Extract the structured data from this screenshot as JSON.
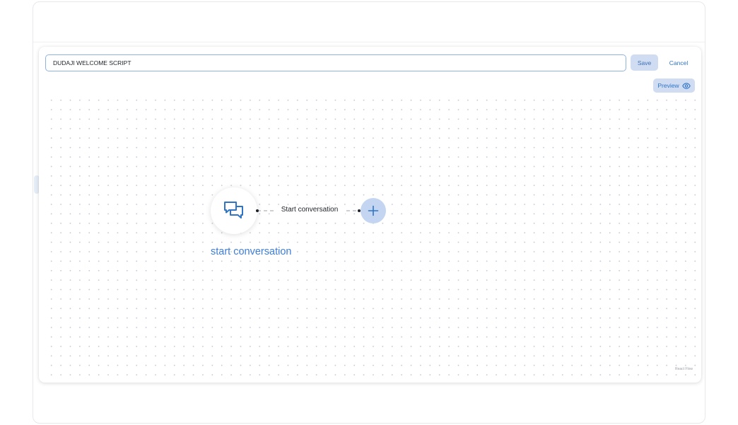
{
  "editor": {
    "script_title_value": "DUDAJI WELCOME SCRIPT",
    "save_label": "Save",
    "cancel_label": "Cancel",
    "preview_label": "Preview"
  },
  "flow": {
    "start_node_label": "start conversation",
    "edge_label": "Start conversation",
    "attribution": "React Flow"
  },
  "icons": {
    "start_node_icon": "chat-bubbles-icon",
    "add_node_icon": "plus-icon",
    "preview_icon": "eye-icon"
  },
  "colors": {
    "accent": "#2f74c7",
    "button_bg": "#cfdcf1",
    "add_node_bg": "#c3d5f0",
    "node_label": "#3f7ed6"
  }
}
